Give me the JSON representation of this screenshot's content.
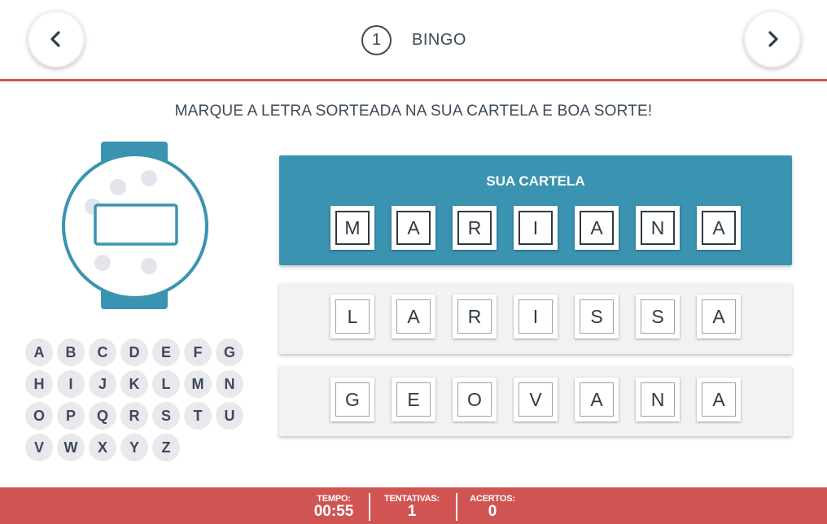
{
  "header": {
    "level": "1",
    "title": "BINGO",
    "prev_icon": "chevron-left-icon",
    "next_icon": "chevron-right-icon"
  },
  "instruction": "MARQUE A LETRA SORTEADA NA SUA CARTELA E BOA SORTE!",
  "machine": {
    "display_text": "",
    "icon": "drawing-machine-icon"
  },
  "alphabet": [
    "A",
    "B",
    "C",
    "D",
    "E",
    "F",
    "G",
    "H",
    "I",
    "J",
    "K",
    "L",
    "M",
    "N",
    "O",
    "P",
    "Q",
    "R",
    "S",
    "T",
    "U",
    "V",
    "W",
    "X",
    "Y",
    "Z"
  ],
  "cards": [
    {
      "title": "SUA CARTELA",
      "letters": [
        "M",
        "A",
        "R",
        "I",
        "A",
        "N",
        "A"
      ],
      "active": true
    },
    {
      "title": "",
      "letters": [
        "L",
        "A",
        "R",
        "I",
        "S",
        "S",
        "A"
      ],
      "active": false
    },
    {
      "title": "",
      "letters": [
        "G",
        "E",
        "O",
        "V",
        "A",
        "N",
        "A"
      ],
      "active": false
    }
  ],
  "footer": {
    "time_label": "TEMPO:",
    "time_value": "00:55",
    "attempts_label": "TENTATIVAS:",
    "attempts_value": "1",
    "hits_label": "ACERTOS:",
    "hits_value": "0"
  },
  "colors": {
    "accent_red": "#d05552",
    "card_blue": "#3a93b1",
    "text_dark": "#3d4a57"
  }
}
